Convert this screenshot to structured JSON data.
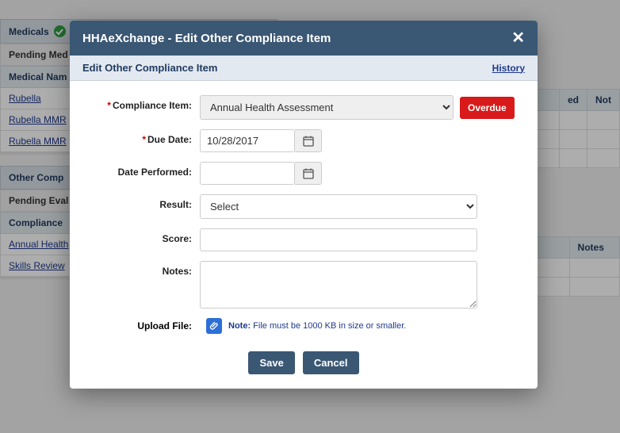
{
  "modal": {
    "window_title": "HHAeXchange - Edit Other Compliance Item",
    "sub_title": "Edit Other Compliance Item",
    "history_link": "History",
    "labels": {
      "compliance_item": "Compliance Item:",
      "due_date": "Due Date:",
      "date_performed": "Date Performed:",
      "result": "Result:",
      "score": "Score:",
      "notes": "Notes:",
      "upload_file": "Upload File:"
    },
    "values": {
      "compliance_item": "Annual Health Assessment",
      "due_date": "10/28/2017",
      "date_performed": "",
      "result": "Select",
      "score": "",
      "notes": ""
    },
    "overdue_badge": "Overdue",
    "upload_note_label": "Note:",
    "upload_note_text": " File must be 1000 KB in size or smaller.",
    "buttons": {
      "save": "Save",
      "cancel": "Cancel"
    },
    "required_marker": "*"
  },
  "background": {
    "medicals_header": "Medicals",
    "pending_med": "Pending Med",
    "medical_name_col": "Medical Nam",
    "med_rows": [
      "Rubella",
      "Rubella MMR",
      "Rubella MMR"
    ],
    "other_comp_header": "Other Comp",
    "pending_eval": "Pending Eval",
    "compliance_col": "Compliance",
    "comp_rows": [
      "Annual Health",
      "Skills Review"
    ],
    "right_cols": {
      "ed": "ed",
      "notes": "Not",
      "notes2": "Notes"
    }
  }
}
